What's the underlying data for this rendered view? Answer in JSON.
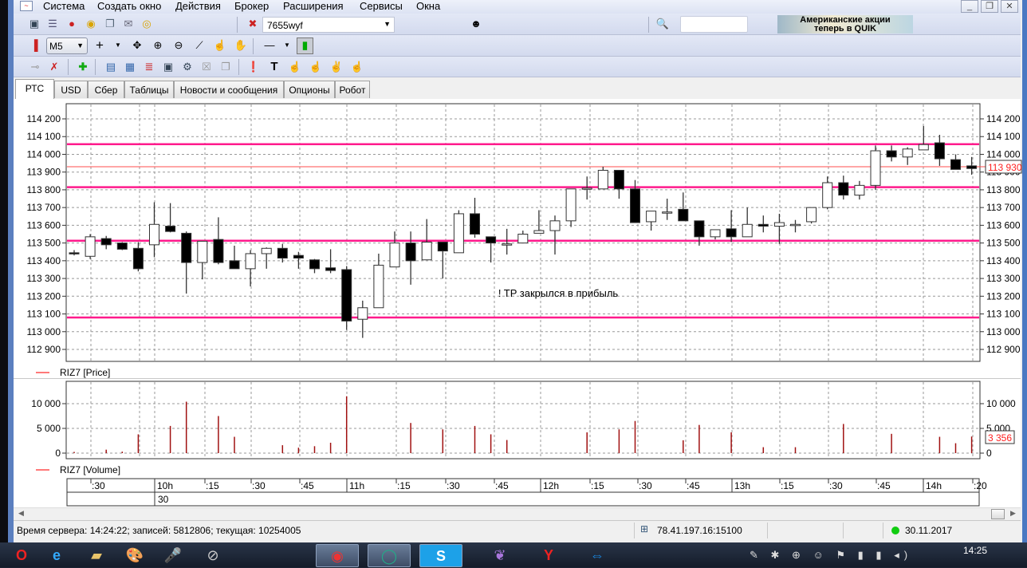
{
  "menu": [
    "Система",
    "Создать окно",
    "Действия",
    "Брокер",
    "Расширения",
    "Сервисы",
    "Окна"
  ],
  "window_controls": {
    "minimize": "_",
    "restore": "❐",
    "close": "✕"
  },
  "toolbar1": {
    "account": "7655wyf",
    "search_value": "",
    "ad_line1": "Американские акции",
    "ad_line2": "теперь в QUIK"
  },
  "toolbar2": {
    "interval": "M5"
  },
  "tabs": [
    "РТС",
    "USD",
    "Сбер",
    "Таблицы",
    "Новости и сообщения",
    "Опционы",
    "Робот"
  ],
  "active_tab": "РТС",
  "colors": {
    "level_line": "#ff1a8c",
    "last_price_line": "#ff4d4d",
    "volume_bar": "#a01010",
    "bear": "#000000",
    "bull": "#ffffff"
  },
  "chart_data": [
    {
      "type": "candlestick",
      "title": "RIZ7 [Price]",
      "ylim": [
        112880,
        114230
      ],
      "y_ticks": [
        114200,
        114100,
        114000,
        113900,
        113800,
        113700,
        113600,
        113500,
        113400,
        113300,
        113200,
        113100,
        113000,
        112900
      ],
      "y_tick_labels": [
        "114 200",
        "114 100",
        "114 000",
        "113 900",
        "113 800",
        "113 700",
        "113 600",
        "113 500",
        "113 400",
        "113 300",
        "113 200",
        "113 100",
        "113 000",
        "112 900"
      ],
      "last_price": 113930,
      "last_price_label": "113 930",
      "levels": [
        114057,
        113815,
        113513,
        113080
      ],
      "annotation": "! TP закрылся в прибыль",
      "ohlc": [
        [
          113445,
          113460,
          113430,
          113440
        ],
        [
          113425,
          113550,
          113410,
          113535
        ],
        [
          113525,
          113540,
          113465,
          113490
        ],
        [
          113500,
          113505,
          113460,
          113465
        ],
        [
          113470,
          113505,
          113340,
          113355
        ],
        [
          113490,
          113730,
          113420,
          113605
        ],
        [
          113595,
          113725,
          113560,
          113565
        ],
        [
          113555,
          113565,
          113215,
          113390
        ],
        [
          113390,
          113510,
          113295,
          113510
        ],
        [
          113520,
          113645,
          113380,
          113390
        ],
        [
          113400,
          113485,
          113355,
          113355
        ],
        [
          113355,
          113460,
          113255,
          113440
        ],
        [
          113440,
          113475,
          113355,
          113470
        ],
        [
          113470,
          113495,
          113390,
          113415
        ],
        [
          113430,
          113450,
          113355,
          113415
        ],
        [
          113405,
          113410,
          113330,
          113355
        ],
        [
          113360,
          113465,
          113330,
          113345
        ],
        [
          113350,
          113370,
          113010,
          113060
        ],
        [
          113070,
          113175,
          112965,
          113135
        ],
        [
          113135,
          113440,
          113135,
          113375
        ],
        [
          113365,
          113565,
          113365,
          113500
        ],
        [
          113500,
          113565,
          113265,
          113400
        ],
        [
          113405,
          113635,
          113405,
          113505
        ],
        [
          113505,
          113505,
          113300,
          113455
        ],
        [
          113445,
          113685,
          113445,
          113665
        ],
        [
          113665,
          113755,
          113530,
          113550
        ],
        [
          113535,
          113535,
          113390,
          113500
        ],
        [
          113495,
          113580,
          113435,
          113495
        ],
        [
          113500,
          113570,
          113500,
          113550
        ],
        [
          113555,
          113685,
          113555,
          113570
        ],
        [
          113570,
          113655,
          113435,
          113625
        ],
        [
          113625,
          113805,
          113590,
          113805
        ],
        [
          113805,
          113875,
          113745,
          113810
        ],
        [
          113805,
          113930,
          113805,
          113910
        ],
        [
          113910,
          113910,
          113750,
          113805
        ],
        [
          113805,
          113855,
          113615,
          113615
        ],
        [
          113620,
          113680,
          113570,
          113680
        ],
        [
          113670,
          113750,
          113630,
          113675
        ],
        [
          113690,
          113785,
          113625,
          113625
        ],
        [
          113625,
          113625,
          113485,
          113535
        ],
        [
          113535,
          113575,
          113520,
          113575
        ],
        [
          113580,
          113685,
          113505,
          113535
        ],
        [
          113535,
          113700,
          113535,
          113605
        ],
        [
          113605,
          113655,
          113560,
          113595
        ],
        [
          113595,
          113665,
          113495,
          113615
        ],
        [
          113605,
          113630,
          113560,
          113605
        ],
        [
          113620,
          113700,
          113610,
          113700
        ],
        [
          113700,
          113875,
          113690,
          113840
        ],
        [
          113840,
          113880,
          113745,
          113770
        ],
        [
          113770,
          113850,
          113745,
          113825
        ],
        [
          113825,
          114050,
          113800,
          114020
        ],
        [
          114020,
          114050,
          113960,
          113985
        ],
        [
          113985,
          114040,
          113940,
          114030
        ],
        [
          114025,
          114160,
          114025,
          114055
        ],
        [
          114065,
          114110,
          113935,
          113975
        ],
        [
          113970,
          114000,
          113915,
          113915
        ],
        [
          113935,
          113985,
          113885,
          113920
        ]
      ]
    },
    {
      "type": "bar",
      "title": "RIZ7 [Volume]",
      "ylim": [
        0,
        11800
      ],
      "y_ticks": [
        10000,
        5000,
        0
      ],
      "y_tick_labels": [
        "10 000",
        "5 000",
        "0"
      ],
      "last_value_label": "3 356",
      "values": [
        250,
        0,
        700,
        300,
        3800,
        0,
        5500,
        10400,
        0,
        7500,
        3300,
        0,
        0,
        1600,
        1100,
        1400,
        2100,
        11500,
        0,
        0,
        0,
        6100,
        0,
        4800,
        0,
        5500,
        3800,
        2650,
        0,
        0,
        0,
        0,
        4200,
        0,
        4800,
        6500,
        0,
        0,
        2600,
        5700,
        0,
        4200,
        0,
        1200,
        0,
        1200,
        0,
        0,
        5900,
        0,
        0,
        3900,
        0,
        0,
        3300,
        2000,
        3356
      ]
    }
  ],
  "time_axis": {
    "labels": [
      ":30",
      "10h",
      ":15",
      ":30",
      ":45",
      "11h",
      ":15",
      ":30",
      ":45",
      "12h",
      ":15",
      ":30",
      ":45",
      "13h",
      ":15",
      ":30",
      ":45",
      "14h",
      ":20"
    ],
    "day_label": "30"
  },
  "status": {
    "server": "Время сервера: 14:24:22; записей: 5812806; текущая: 10254005",
    "connection": "78.41.197.16:15100",
    "date": "30.11.2017"
  },
  "taskbar": {
    "clock": "14:25"
  }
}
